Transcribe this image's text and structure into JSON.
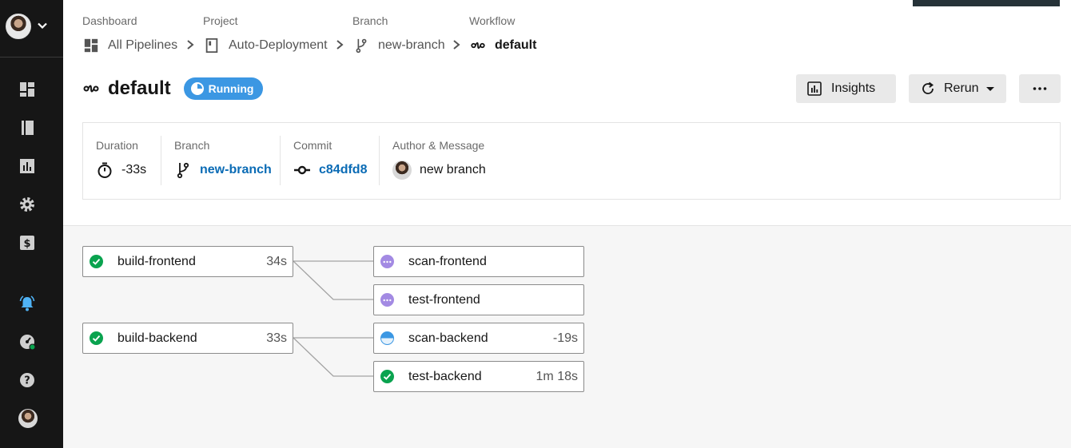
{
  "app": {
    "accent_color": "#3b97e3",
    "sidebar_bg": "#161616"
  },
  "sidebar": {
    "items": [
      {
        "name": "dashboard-icon"
      },
      {
        "name": "projects-icon"
      },
      {
        "name": "insights-icon"
      },
      {
        "name": "settings-icon"
      },
      {
        "name": "plan-icon"
      },
      {
        "name": "notifications-icon"
      },
      {
        "name": "status-icon"
      },
      {
        "name": "help-icon"
      }
    ]
  },
  "breadcrumb": {
    "dashboard": {
      "label": "Dashboard",
      "value": "All Pipelines"
    },
    "project": {
      "label": "Project",
      "value": "Auto-Deployment"
    },
    "branch": {
      "label": "Branch",
      "value": "new-branch"
    },
    "workflow": {
      "label": "Workflow",
      "value": "default"
    }
  },
  "header": {
    "title": "default",
    "status": "Running",
    "insights_label": "Insights",
    "rerun_label": "Rerun",
    "more_label": "•••"
  },
  "details": {
    "duration": {
      "label": "Duration",
      "value": "-33s"
    },
    "branch": {
      "label": "Branch",
      "value": "new-branch"
    },
    "commit": {
      "label": "Commit",
      "value": "c84dfd8"
    },
    "author": {
      "label": "Author & Message",
      "value": "new branch"
    }
  },
  "jobs": [
    {
      "name": "build-frontend",
      "status": "success",
      "duration": "34s"
    },
    {
      "name": "scan-frontend",
      "status": "waiting",
      "duration": ""
    },
    {
      "name": "test-frontend",
      "status": "waiting",
      "duration": ""
    },
    {
      "name": "build-backend",
      "status": "success",
      "duration": "33s"
    },
    {
      "name": "scan-backend",
      "status": "running",
      "duration": "-19s"
    },
    {
      "name": "test-backend",
      "status": "success",
      "duration": "1m 18s"
    }
  ],
  "status_colors": {
    "success": "#0aa34f",
    "waiting": "#a38ae3",
    "running": "#3b97e3"
  }
}
